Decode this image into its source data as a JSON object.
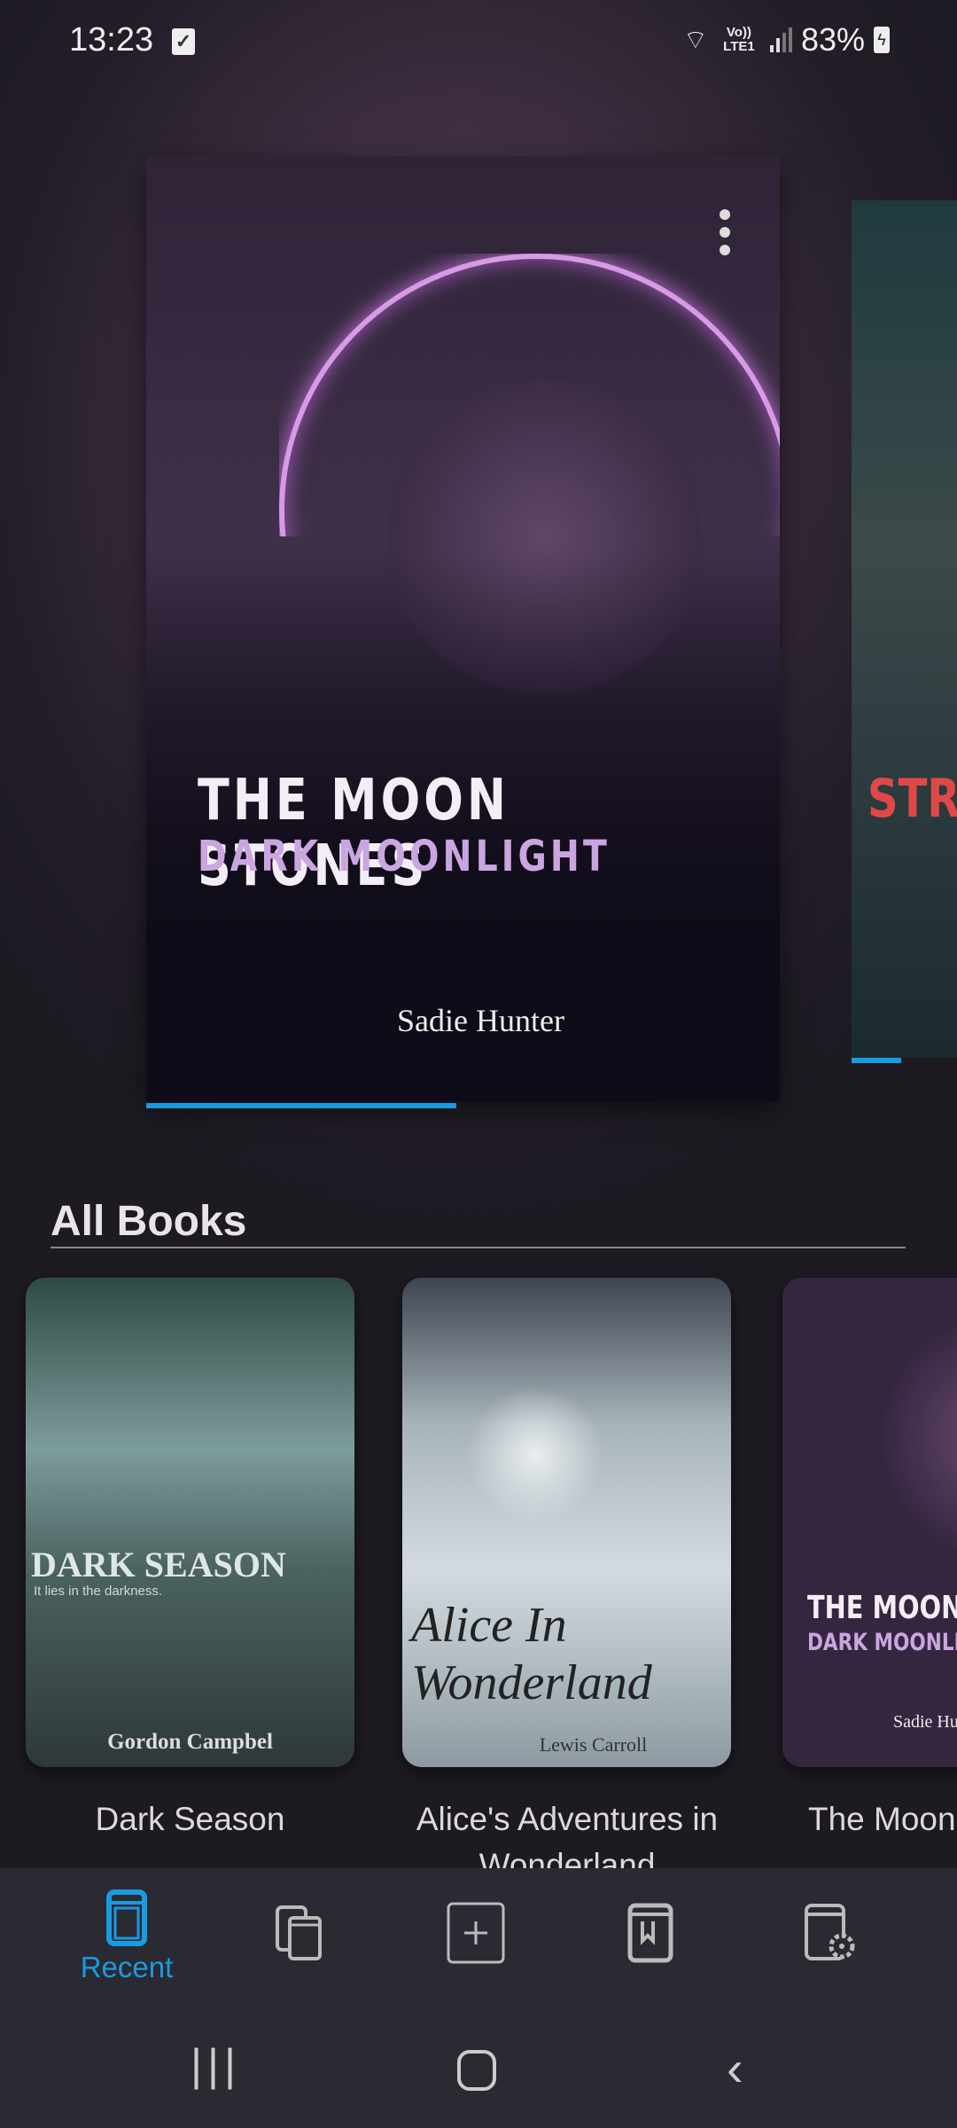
{
  "status_bar": {
    "time": "13:23",
    "network": "Vo)) LTE1",
    "battery": "83%"
  },
  "featured": [
    {
      "title": "THE MOON STONES",
      "subtitle": "DARK MOONLIGHT",
      "author": "Sadie Hunter",
      "progress_percent": 49
    },
    {
      "title_partial": "STRA",
      "progress_percent": 25
    }
  ],
  "section": {
    "title": "All Books"
  },
  "books": [
    {
      "cover_title": "DARK SEASON",
      "cover_tagline": "It lies in the darkness.",
      "cover_author": "Gordon Campbel",
      "title": "Dark Season"
    },
    {
      "cover_title_line1": "Alice In",
      "cover_title_line2": "Wonderland",
      "cover_author": "Lewis Carroll",
      "title": "Alice's Adventures in Wonderland"
    },
    {
      "cover_title": "THE MOON",
      "cover_subtitle": "DARK MOONLI",
      "cover_author": "Sadie Hu",
      "title": "The Moon"
    }
  ],
  "bottom_nav": {
    "active": "recent",
    "items": [
      {
        "id": "recent",
        "label": "Recent",
        "icon": "book-icon"
      },
      {
        "id": "collections",
        "label": "",
        "icon": "books-stack-icon"
      },
      {
        "id": "add",
        "label": "",
        "icon": "add-book-icon"
      },
      {
        "id": "bookmarks",
        "label": "",
        "icon": "bookmark-book-icon"
      },
      {
        "id": "settings",
        "label": "",
        "icon": "book-settings-icon"
      }
    ]
  },
  "colors": {
    "accent": "#1a9ae0",
    "nav_bg": "#2a2a33"
  }
}
